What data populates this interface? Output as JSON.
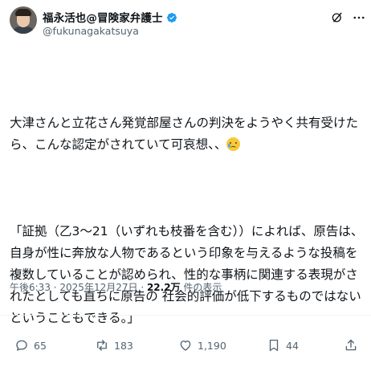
{
  "author": {
    "display_name": "福永活也@冒険家弁護士",
    "handle": "@fukunagakatsuya"
  },
  "icons": {
    "avatar": "profile-photo",
    "verified": "verified-badge-icon",
    "grok": "grok-icon",
    "more": "more-icon",
    "reply": "reply-icon",
    "repost": "repost-icon",
    "like": "heart-icon",
    "views": "bar-chart-icon",
    "share": "share-icon",
    "emoji": "crying-face-emoji"
  },
  "colors": {
    "verified": "#1d9bf0",
    "text": "#0f1419",
    "muted": "#536471"
  },
  "tweet": {
    "paragraph1": "大津さんと立花さん発覚部屋さんの判決をようやく共有受けたら、こんな認定がされていて可哀想、、",
    "paragraph2": "「証拠（乙3～21（いずれも枝番を含む））によれば、原告は、自身が性に奔放な人物であるという印象を与えるような投稿を複数していることが認められ、性的な事柄に関連する表現がされたとしても直ちに原告の 社会的評価が低下するものではないということもできる。」"
  },
  "meta": {
    "time": "午後6:33",
    "separator": " · ",
    "date": "2025年12月27日",
    "separator2": " · ",
    "views_count": "22.2万",
    "views_label": " 件の表示"
  },
  "actions": {
    "replies": "65",
    "reposts": "183",
    "likes": "1,190",
    "bookmarks": "44"
  }
}
